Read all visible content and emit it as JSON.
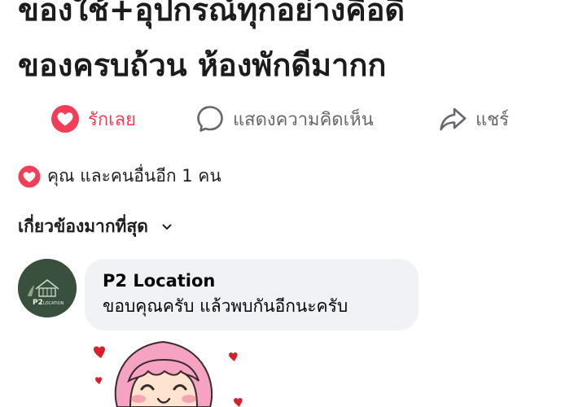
{
  "post": {
    "line1": "ของใช้+อุปกรณ์ทุกอย่างคือดี",
    "line2": "ของครบถ้วน ห้องพักดีมากก"
  },
  "actions": {
    "love_label": "รักเลย",
    "comment_label": "แสดงความคิดเห็น",
    "share_label": "แชร์"
  },
  "reactions": {
    "summary": "คุณ และคนอื่นอีก 1 คน"
  },
  "sort": {
    "label": "เกี่ยวข้องมากที่สุด"
  },
  "comment": {
    "author": "P2 Location",
    "text": "ขอบคุณครับ แล้วพบกันอีกนะครับ",
    "avatar_logo_text": "P2 LOCATION"
  },
  "colors": {
    "love": "#f33e58",
    "muted": "#65676b",
    "bubble": "#f0f2f5",
    "avatar_bg": "#38503d"
  },
  "icons": {
    "love": "heart-icon",
    "comment": "speech-bubble-icon",
    "share": "share-arrow-icon",
    "sort": "chevron-down-icon"
  }
}
